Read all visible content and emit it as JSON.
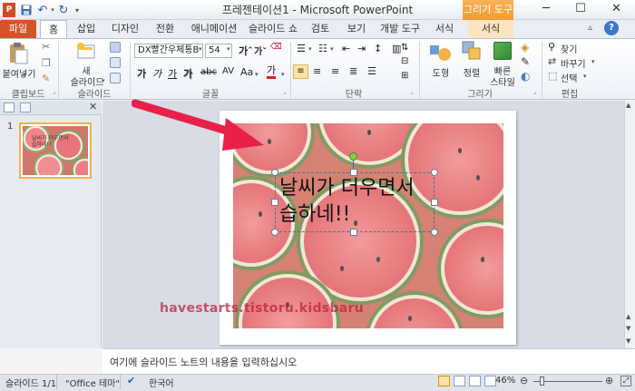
{
  "window": {
    "title": "프레젠테이션1 - Microsoft PowerPoint",
    "context_tab_header": "그리기 도구",
    "colors": {
      "file_tab": "#d3542a",
      "context_header": "#f5a53f",
      "selection_orange": "#f2b14b",
      "arrow": "#e8204a"
    }
  },
  "tabs": [
    "파일",
    "홈",
    "삽입",
    "디자인",
    "전환",
    "애니메이션",
    "슬라이드 쇼",
    "검토",
    "보기",
    "개발 도구",
    "서식",
    "서식"
  ],
  "ribbon": {
    "clipboard": {
      "paste": "붙여넣기",
      "group": "클립보드"
    },
    "slides": {
      "new_line1": "새",
      "new_line2": "슬라이드",
      "group": "슬라이드"
    },
    "font": {
      "name": "DX빨간우체통B",
      "size": "54",
      "group": "글꼴",
      "bold": "가",
      "italic": "가",
      "underline": "가",
      "strike": "가",
      "case": "Aa",
      "color": "가"
    },
    "paragraph": {
      "group": "단락"
    },
    "drawing": {
      "shape": "도형",
      "arrange": "정렬",
      "quick_line1": "빠른",
      "quick_line2": "스타일",
      "group": "그리기"
    },
    "editing": {
      "find": "찾기",
      "replace": "바꾸기",
      "select": "선택",
      "group": "편집"
    }
  },
  "slide": {
    "number": "1",
    "text_line1": "날씨가 더우면서",
    "text_line2": "습하네!!",
    "watermark": "havestarts.tistoru.kidsbaru"
  },
  "notes": {
    "placeholder": "여기에 슬라이드 노트의 내용을 입력하십시오"
  },
  "status": {
    "slide_of": "슬라이드 1/1",
    "theme": "\"Office 테마\"",
    "language": "한국어",
    "zoom": "46%"
  }
}
